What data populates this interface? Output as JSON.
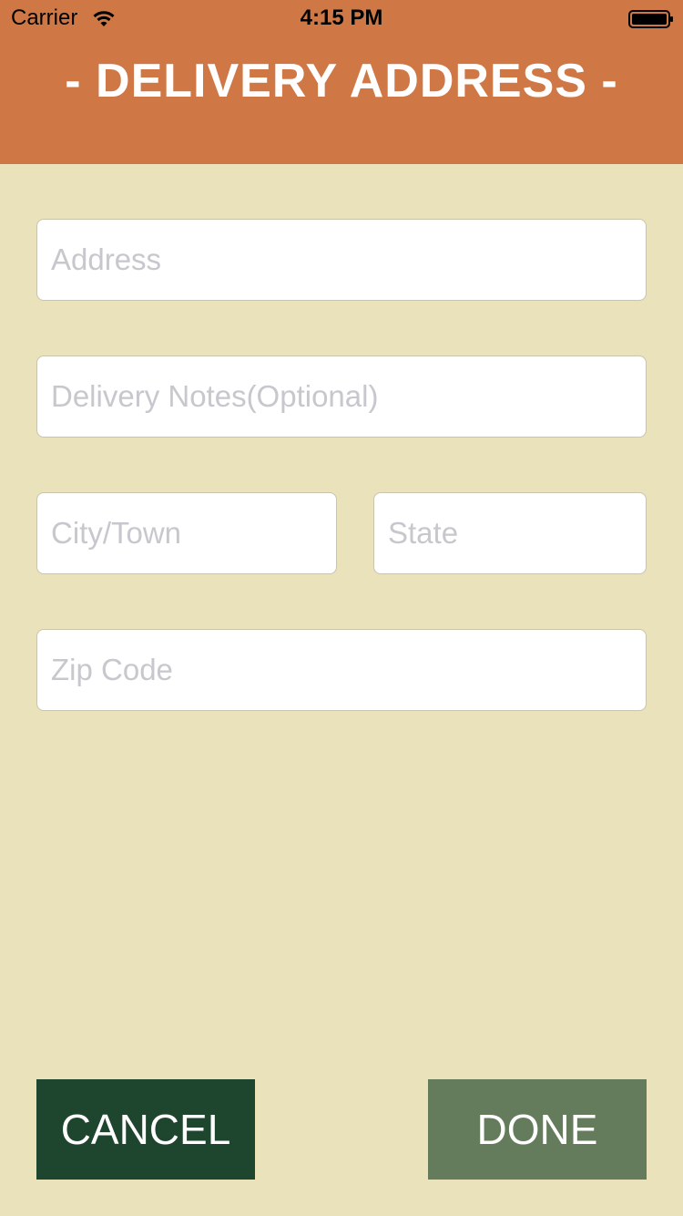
{
  "status_bar": {
    "carrier": "Carrier",
    "time": "4:15 PM",
    "wifi_icon": "wifi-icon",
    "battery_icon": "battery-icon"
  },
  "header": {
    "title": "- DELIVERY ADDRESS -",
    "background_color": "#CF7846"
  },
  "form": {
    "address": {
      "placeholder": "Address",
      "value": ""
    },
    "delivery_notes": {
      "placeholder": "Delivery Notes(Optional)",
      "value": ""
    },
    "city": {
      "placeholder": "City/Town",
      "value": ""
    },
    "state": {
      "placeholder": "State",
      "value": ""
    },
    "zip": {
      "placeholder": "Zip Code",
      "value": ""
    }
  },
  "buttons": {
    "cancel_label": "CANCEL",
    "done_label": "DONE"
  },
  "colors": {
    "page_background": "#E9E2BB",
    "cancel_button": "#1E452D",
    "done_button": "#657C5C"
  }
}
